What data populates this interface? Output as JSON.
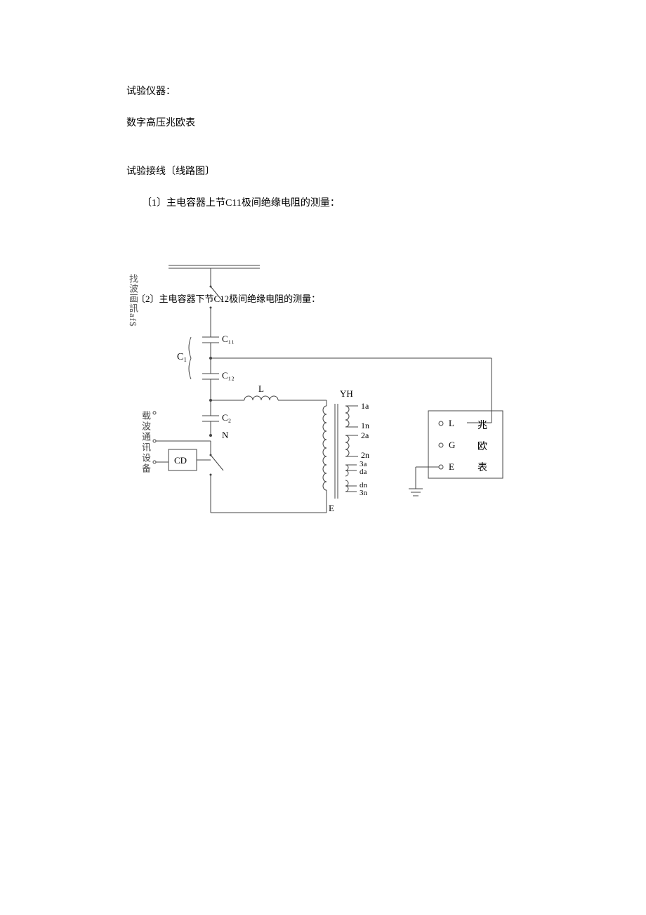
{
  "paragraphs": {
    "p1": "试验仪器：",
    "p2": "数字高压兆欧表",
    "p3": "试验接线〔线路图〕",
    "p4": "〔1〕主电容器上节C11极间绝缘电阻的测量：",
    "p5": "〔2〕主电容器下节C12极间绝缘电阻的测量："
  },
  "leftText1": "找波画訊af$",
  "leftText2": "载波通讯设备",
  "labels": {
    "C11": "C₁₁",
    "C12": "C₁₂",
    "C1": "C₁",
    "C2": "C₂",
    "L": "L",
    "N": "N",
    "YH": "YH",
    "CD": "CD",
    "E": "E",
    "G": "G",
    "right1": "兆",
    "right2": "欧",
    "right3": "表",
    "w1a": "1a",
    "w1n": "1n",
    "w2a": "2a",
    "w2n": "2n",
    "w3a": "3a",
    "wda": "da",
    "wdn": "dn",
    "w3n": "3n"
  },
  "port": {
    "o": "o"
  }
}
